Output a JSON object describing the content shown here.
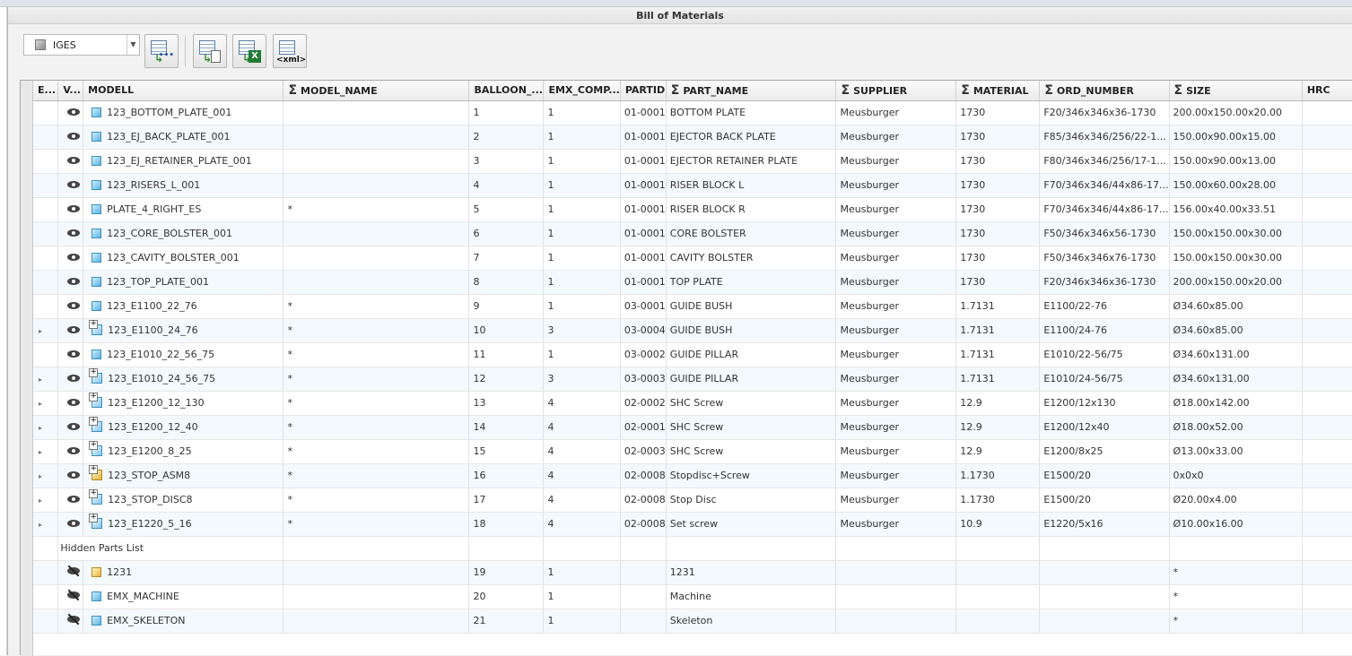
{
  "window": {
    "title": "Bill of Materials"
  },
  "toolbar": {
    "format_value": "IGES",
    "buttons": [
      "export-table",
      "export-document",
      "export-excel",
      "export-xml"
    ],
    "xml_label": "<xml>",
    "excel_label": "X"
  },
  "columns": [
    "E...",
    "V...",
    "MODELL",
    "MODEL_NAME",
    "BALLOON_...",
    "EMX_COMP...",
    "PARTID",
    "PART_NAME",
    "SUPPLIER",
    "MATERIAL",
    "ORD_NUMBER",
    "SIZE",
    "HRC"
  ],
  "rows": [
    {
      "expand": "",
      "visible": true,
      "icon": "part",
      "modell": "123_BOTTOM_PLATE_001",
      "model_name": "",
      "balloon": "1",
      "emx": "1",
      "partid": "01-0001",
      "part_name": "BOTTOM PLATE",
      "supplier": "Meusburger",
      "material": "1730",
      "ord": "F20/346x346x36-1730",
      "size": "200.00x150.00x20.00",
      "hrc": ""
    },
    {
      "expand": "",
      "visible": true,
      "icon": "part",
      "modell": "123_EJ_BACK_PLATE_001",
      "model_name": "",
      "balloon": "2",
      "emx": "1",
      "partid": "01-0001",
      "part_name": "EJECTOR BACK PLATE",
      "supplier": "Meusburger",
      "material": "1730",
      "ord": "F85/346x346/256/22-1...",
      "size": "150.00x90.00x15.00",
      "hrc": ""
    },
    {
      "expand": "",
      "visible": true,
      "icon": "part",
      "modell": "123_EJ_RETAINER_PLATE_001",
      "model_name": "",
      "balloon": "3",
      "emx": "1",
      "partid": "01-0001",
      "part_name": "EJECTOR RETAINER PLATE",
      "supplier": "Meusburger",
      "material": "1730",
      "ord": "F80/346x346/256/17-1...",
      "size": "150.00x90.00x13.00",
      "hrc": ""
    },
    {
      "expand": "",
      "visible": true,
      "icon": "part",
      "modell": "123_RISERS_L_001",
      "model_name": "",
      "balloon": "4",
      "emx": "1",
      "partid": "01-0001",
      "part_name": "RISER BLOCK L",
      "supplier": "Meusburger",
      "material": "1730",
      "ord": "F70/346x346/44x86-17...",
      "size": "150.00x60.00x28.00",
      "hrc": ""
    },
    {
      "expand": "",
      "visible": true,
      "icon": "part",
      "modell": "PLATE_4_RIGHT_ES",
      "model_name": "*",
      "balloon": "5",
      "emx": "1",
      "partid": "01-0001",
      "part_name": "RISER BLOCK R",
      "supplier": "Meusburger",
      "material": "1730",
      "ord": "F70/346x346/44x86-17...",
      "size": "156.00x40.00x33.51",
      "hrc": ""
    },
    {
      "expand": "",
      "visible": true,
      "icon": "part",
      "modell": "123_CORE_BOLSTER_001",
      "model_name": "",
      "balloon": "6",
      "emx": "1",
      "partid": "01-0001",
      "part_name": "CORE BOLSTER",
      "supplier": "Meusburger",
      "material": "1730",
      "ord": "F50/346x346x56-1730",
      "size": "150.00x150.00x30.00",
      "hrc": ""
    },
    {
      "expand": "",
      "visible": true,
      "icon": "part",
      "modell": "123_CAVITY_BOLSTER_001",
      "model_name": "",
      "balloon": "7",
      "emx": "1",
      "partid": "01-0001",
      "part_name": "CAVITY BOLSTER",
      "supplier": "Meusburger",
      "material": "1730",
      "ord": "F50/346x346x76-1730",
      "size": "150.00x150.00x30.00",
      "hrc": ""
    },
    {
      "expand": "",
      "visible": true,
      "icon": "part",
      "modell": "123_TOP_PLATE_001",
      "model_name": "",
      "balloon": "8",
      "emx": "1",
      "partid": "01-0001",
      "part_name": "TOP PLATE",
      "supplier": "Meusburger",
      "material": "1730",
      "ord": "F20/346x346x36-1730",
      "size": "200.00x150.00x20.00",
      "hrc": ""
    },
    {
      "expand": "",
      "visible": true,
      "icon": "part",
      "modell": "123_E1100_22_76",
      "model_name": "*",
      "balloon": "9",
      "emx": "1",
      "partid": "03-0001",
      "part_name": "GUIDE BUSH",
      "supplier": "Meusburger",
      "material": "1.7131",
      "ord": "E1100/22-76",
      "size": "Ø34.60x85.00",
      "hrc": ""
    },
    {
      "expand": "▸",
      "visible": true,
      "icon": "asm",
      "modell": "123_E1100_24_76",
      "model_name": "*",
      "balloon": "10",
      "emx": "3",
      "partid": "03-0004",
      "part_name": "GUIDE BUSH",
      "supplier": "Meusburger",
      "material": "1.7131",
      "ord": "E1100/24-76",
      "size": "Ø34.60x85.00",
      "hrc": ""
    },
    {
      "expand": "",
      "visible": true,
      "icon": "part",
      "modell": "123_E1010_22_56_75",
      "model_name": "*",
      "balloon": "11",
      "emx": "1",
      "partid": "03-0002",
      "part_name": "GUIDE PILLAR",
      "supplier": "Meusburger",
      "material": "1.7131",
      "ord": "E1010/22-56/75",
      "size": "Ø34.60x131.00",
      "hrc": ""
    },
    {
      "expand": "▸",
      "visible": true,
      "icon": "asm",
      "modell": "123_E1010_24_56_75",
      "model_name": "*",
      "balloon": "12",
      "emx": "3",
      "partid": "03-0003",
      "part_name": "GUIDE PILLAR",
      "supplier": "Meusburger",
      "material": "1.7131",
      "ord": "E1010/24-56/75",
      "size": "Ø34.60x131.00",
      "hrc": ""
    },
    {
      "expand": "▸",
      "visible": true,
      "icon": "asm",
      "modell": "123_E1200_12_130",
      "model_name": "*",
      "balloon": "13",
      "emx": "4",
      "partid": "02-0002",
      "part_name": "SHC Screw",
      "supplier": "Meusburger",
      "material": "12.9",
      "ord": "E1200/12x130",
      "size": "Ø18.00x142.00",
      "hrc": ""
    },
    {
      "expand": "▸",
      "visible": true,
      "icon": "asm",
      "modell": "123_E1200_12_40",
      "model_name": "*",
      "balloon": "14",
      "emx": "4",
      "partid": "02-0001",
      "part_name": "SHC Screw",
      "supplier": "Meusburger",
      "material": "12.9",
      "ord": "E1200/12x40",
      "size": "Ø18.00x52.00",
      "hrc": ""
    },
    {
      "expand": "▸",
      "visible": true,
      "icon": "asm",
      "modell": "123_E1200_8_25",
      "model_name": "*",
      "balloon": "15",
      "emx": "4",
      "partid": "02-0003",
      "part_name": "SHC Screw",
      "supplier": "Meusburger",
      "material": "12.9",
      "ord": "E1200/8x25",
      "size": "Ø13.00x33.00",
      "hrc": ""
    },
    {
      "expand": "▸",
      "visible": true,
      "icon": "asmy",
      "modell": "123_STOP_ASM8",
      "model_name": "*",
      "balloon": "16",
      "emx": "4",
      "partid": "02-0008",
      "part_name": "Stopdisc+Screw",
      "supplier": "Meusburger",
      "material": "1.1730",
      "ord": "E1500/20",
      "size": "0x0x0",
      "hrc": ""
    },
    {
      "expand": "▸",
      "visible": true,
      "icon": "asm",
      "modell": "123_STOP_DISC8",
      "model_name": "*",
      "balloon": "17",
      "emx": "4",
      "partid": "02-0008",
      "part_name": "Stop Disc",
      "supplier": "Meusburger",
      "material": "1.1730",
      "ord": "E1500/20",
      "size": "Ø20.00x4.00",
      "hrc": ""
    },
    {
      "expand": "▸",
      "visible": true,
      "icon": "asm",
      "modell": "123_E1220_5_16",
      "model_name": "*",
      "balloon": "18",
      "emx": "4",
      "partid": "02-0008",
      "part_name": "Set screw",
      "supplier": "Meusburger",
      "material": "10.9",
      "ord": "E1220/5x16",
      "size": "Ø10.00x16.00",
      "hrc": ""
    }
  ],
  "hidden_label": "Hidden Parts List",
  "hidden_rows": [
    {
      "icon": "asmy-plain",
      "modell": "1231",
      "balloon": "19",
      "emx": "1",
      "part_name": "1231",
      "size": "*"
    },
    {
      "icon": "part",
      "modell": "EMX_MACHINE",
      "balloon": "20",
      "emx": "1",
      "part_name": "Machine",
      "size": "*"
    },
    {
      "icon": "part",
      "modell": "EMX_SKELETON",
      "balloon": "21",
      "emx": "1",
      "part_name": "Skeleton",
      "size": "*"
    }
  ]
}
